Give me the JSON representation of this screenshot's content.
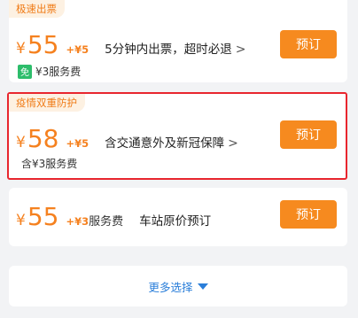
{
  "options": [
    {
      "tag": "极速出票",
      "currency": "¥",
      "price": "55",
      "extra": "+¥5",
      "extra_note": "",
      "description": "5分钟内出票，超时必退",
      "chevron": ">",
      "sub_icon": "免",
      "sub_text": "¥3服务费",
      "button": "预订"
    },
    {
      "tag": "疫情双重防护",
      "currency": "¥",
      "price": "58",
      "extra": "+¥5",
      "extra_note": "",
      "description": "含交通意外及新冠保障",
      "chevron": ">",
      "sub_text": "含¥3服务费",
      "button": "预订"
    },
    {
      "currency": "¥",
      "price": "55",
      "extra": "+¥3",
      "extra_note": "服务费",
      "description": "车站原价预订",
      "button": "预订"
    }
  ],
  "more": {
    "label": "更多选择",
    "icon": "triangle-down-icon"
  },
  "colors": {
    "accent": "#f5811f",
    "button": "#f68a1f",
    "highlight_border": "#e8262e",
    "link": "#2a7ed9",
    "free_badge": "#2dbd6b"
  }
}
